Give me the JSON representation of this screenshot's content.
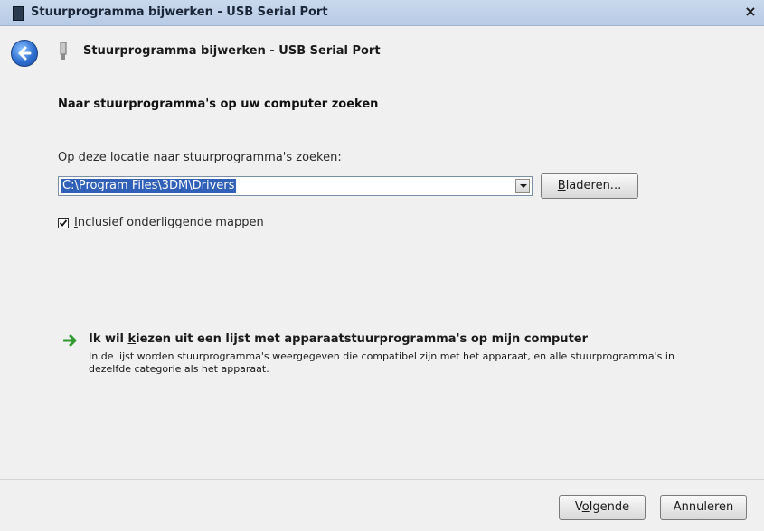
{
  "window": {
    "title": "Stuurprogramma bijwerken - USB Serial Port",
    "close_label": "×"
  },
  "nav": {
    "title": "Stuurprogramma bijwerken - USB Serial Port",
    "back_icon": "back-arrow-icon"
  },
  "main": {
    "heading": "Naar stuurprogramma's op uw computer zoeken",
    "search_label": "Op deze locatie naar stuurprogramma's zoeken:",
    "path_value": "C:\\Program Files\\3DM\\Drivers",
    "browse_label_prefix": "",
    "browse_label_u": "B",
    "browse_label_rest": "laderen...",
    "include_checked": true,
    "include_label_u": "I",
    "include_label_rest": "nclusief onderliggende mappen",
    "choose_title_prefix": "Ik wil ",
    "choose_title_u": "k",
    "choose_title_rest": "iezen uit een lijst met apparaatstuurprogramma's op mijn computer",
    "choose_desc": "In de lijst worden stuurprogramma's weergegeven die compatibel zijn met het apparaat, en alle stuurprogramma's in dezelfde categorie als het apparaat."
  },
  "footer": {
    "next_prefix": "V",
    "next_u": "o",
    "next_rest": "lgende",
    "cancel_label": "Annuleren"
  },
  "colors": {
    "accent": "#3060b8",
    "green_arrow": "#2f9a2f"
  }
}
